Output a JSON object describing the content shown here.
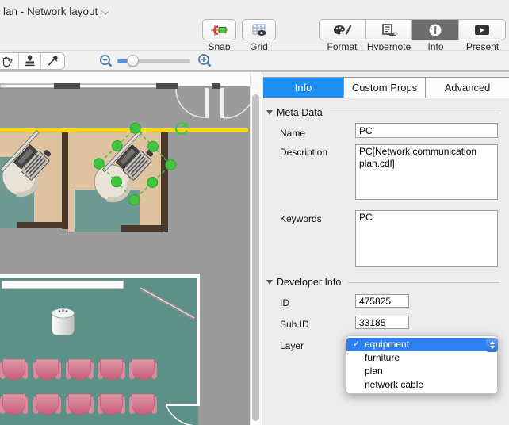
{
  "window": {
    "title": "lan - Network layout"
  },
  "toolbar": {
    "snap_label": "Snap",
    "grid_label": "Grid",
    "format_label": "Format",
    "hypernote_label": "Hypernote",
    "info_label": "Info",
    "present_label": "Present"
  },
  "panel": {
    "tabs": {
      "info": "Info",
      "custom_props": "Custom Props",
      "advanced": "Advanced"
    },
    "meta": {
      "section_title": "Meta Data",
      "name_label": "Name",
      "name_value": "PC",
      "description_label": "Description",
      "description_value": "PC[Network communication plan.cdl]",
      "keywords_label": "Keywords",
      "keywords_value": "PC"
    },
    "developer": {
      "section_title": "Developer Info",
      "id_label": "ID",
      "id_value": "475825",
      "sub_id_label": "Sub ID",
      "sub_id_value": "33185",
      "layer_label": "Layer"
    },
    "layer_menu": {
      "checkmark": "✓",
      "selected": "equipment",
      "items": [
        "equipment",
        "furniture",
        "plan",
        "network cable"
      ]
    }
  },
  "colors": {
    "tab_accent_blue": "#1d8ff2",
    "menu_selection_blue": "#2f7ef2",
    "selection_green": "#3fc53f",
    "cable_yellow": "#ffd900",
    "floor_gray": "#9b9b9b",
    "carpet_teal": "#6d9b93",
    "room_teal": "#5d9187",
    "desk_tan": "#dfc2a0",
    "chair_pink": "#d0718a"
  }
}
